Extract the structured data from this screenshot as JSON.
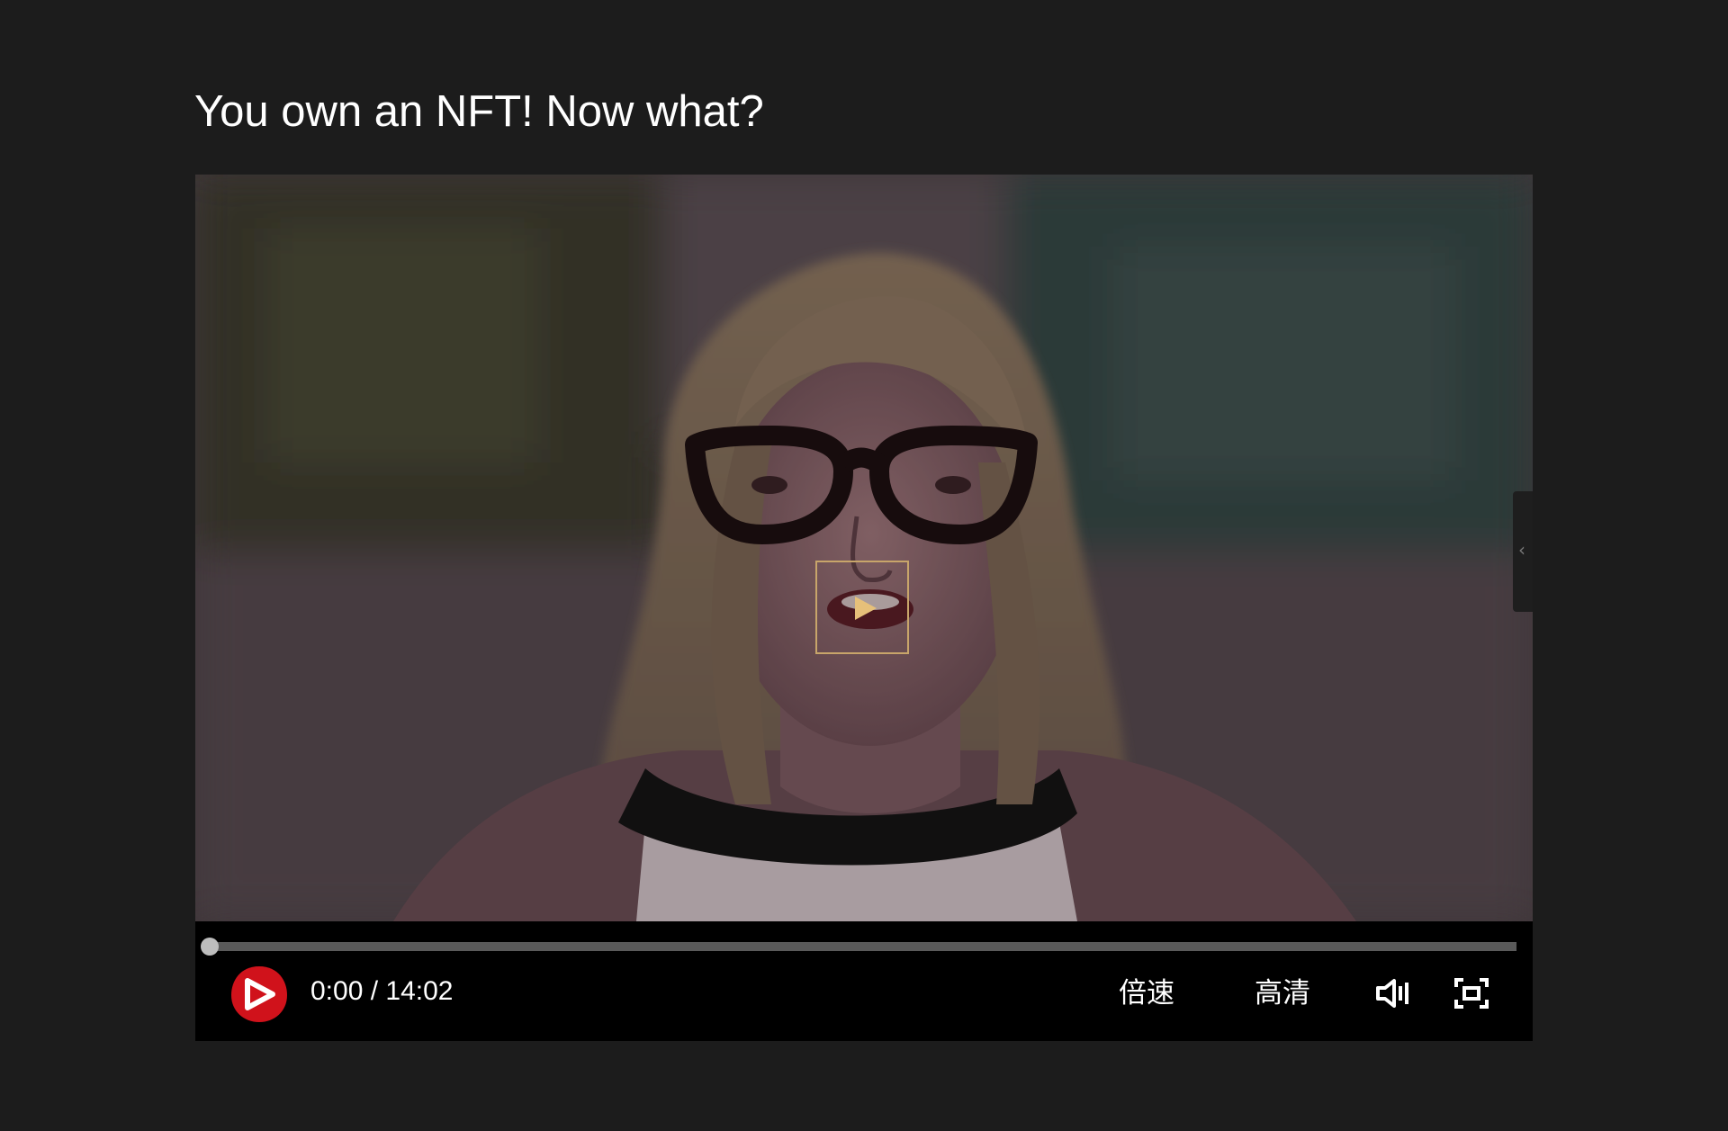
{
  "page": {
    "title": "You own an NFT! Now what?"
  },
  "player": {
    "current_time": "0:00",
    "duration": "14:02",
    "time_display": "0:00 / 14:02",
    "progress_fraction": 0,
    "speed_label": "倍速",
    "quality_label": "高清",
    "icons": {
      "play_overlay": "play-icon",
      "play_button": "play-logo-icon",
      "volume": "volume-icon",
      "fullscreen": "fullscreen-icon",
      "side_panel": "chevron-left-icon"
    },
    "colors": {
      "overlay_border": "#c8a56a",
      "play_button": "#d0121b",
      "controls_bg": "#000000"
    }
  }
}
